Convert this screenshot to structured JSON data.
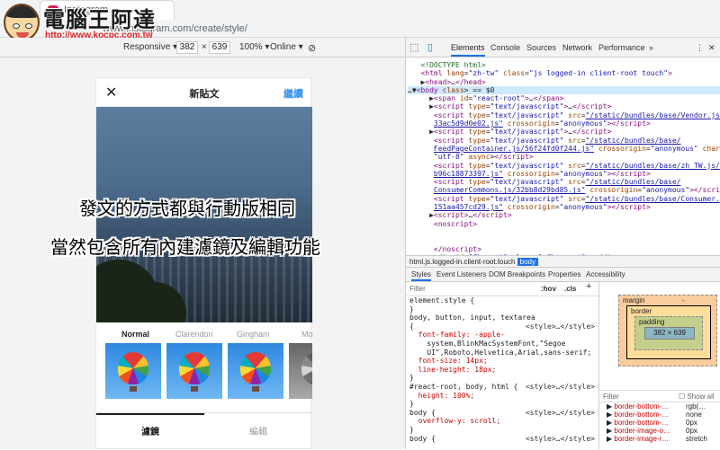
{
  "browser": {
    "tab_title": "Instagram",
    "url": "www.instagram.com/create/style/"
  },
  "watermark": {
    "title": "電腦王阿達",
    "site": "http://www.kocpc.com.tw"
  },
  "device_toolbar": {
    "device": "Responsive ▾",
    "width": "382",
    "times": "×",
    "height": "639",
    "zoom": "100% ▾",
    "network": "Online ▾"
  },
  "app": {
    "close": "✕",
    "title": "新貼文",
    "next": "繼續",
    "filter_labels": [
      "Normal",
      "Clarendon",
      "Gingham",
      "Mo"
    ],
    "tab_filter": "濾鏡",
    "tab_edit": "編輯"
  },
  "overlay": {
    "line1": "發文的方式都與行動版相同",
    "line2": "當然包含所有內建濾鏡及編輯功能"
  },
  "devtools": {
    "tabs": [
      "Elements",
      "Console",
      "Sources",
      "Network",
      "Performance",
      "»"
    ],
    "more": "⋮",
    "close": "✕",
    "breadcrumb_html": "html.js.logged-in.client-root.touch",
    "breadcrumb_body": "body",
    "sub_tabs": [
      "Styles",
      "Event Listeners",
      "DOM Breakpoints",
      "Properties",
      "Accessibility"
    ],
    "filter_placeholder": "Filter",
    "hov": ":hov",
    "cls": ".cls",
    "plus": "+",
    "styles_lines": [
      "element.style {",
      "}",
      "body, button, input, textarea",
      "{",
      "  font-family: -apple-",
      "    system,BlinkMacSystemFont,\"Segoe",
      "    UI\",Roboto,Helvetica,Arial,sans-serif;",
      "  font-size: 14px;",
      "  line-height: 18px;",
      "}",
      "#react-root, body, html {",
      "  height: 100%;",
      "}",
      "body {",
      "  overflow-y: scroll;",
      "}",
      "body {"
    ],
    "styles_src": [
      "<style>…</style>",
      "<style>…</style>",
      "<style>…</style>",
      "<style>…</style>"
    ],
    "box": {
      "margin": "margin",
      "border": "border",
      "padding": "padding",
      "content": "382 × 639",
      "dash": "-"
    },
    "computed_filter": "Filter",
    "show_all": "Show all",
    "computed": [
      {
        "k": "border-bottom-…",
        "v": "rgb(…"
      },
      {
        "k": "border-bottom-…",
        "v": "none"
      },
      {
        "k": "border-bottom-…",
        "v": "0px"
      },
      {
        "k": "border-image-o…",
        "v": "0px"
      },
      {
        "k": "border-image-r…",
        "v": "stretch"
      }
    ]
  }
}
